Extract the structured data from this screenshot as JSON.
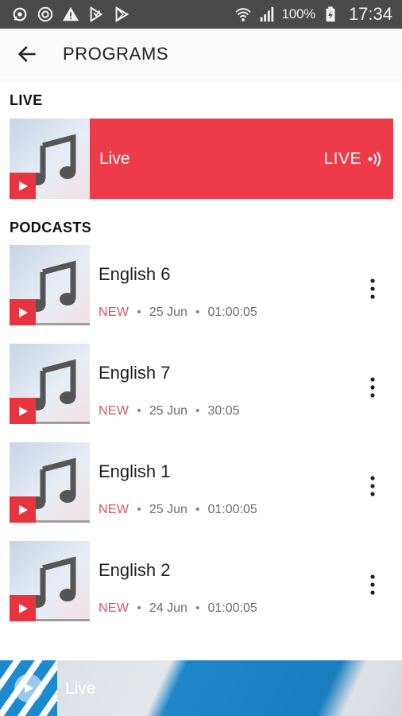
{
  "status_bar": {
    "left_icons": [
      "whatsapp-icon",
      "sync-icon",
      "warning-icon",
      "download-icon",
      "play-store-icon"
    ],
    "right_icons": [
      "wifi-icon",
      "signal-icon",
      "battery-charging-icon"
    ],
    "battery": "100%",
    "time": "17:34"
  },
  "app_bar": {
    "back_icon": "arrow-left-icon",
    "title": "PROGRAMS"
  },
  "live_section": {
    "heading": "LIVE",
    "item": {
      "title": "Live",
      "badge": "LIVE",
      "badge_icon": "broadcast-icon"
    }
  },
  "podcasts_section": {
    "heading": "PODCASTS",
    "items": [
      {
        "title": "English 6",
        "status": "NEW",
        "date": "25 Jun",
        "duration": "01:00:05"
      },
      {
        "title": "English 7",
        "status": "NEW",
        "date": "25 Jun",
        "duration": "30:05"
      },
      {
        "title": "English 1",
        "status": "NEW",
        "date": "25 Jun",
        "duration": "01:00:05"
      },
      {
        "title": "English 2",
        "status": "NEW",
        "date": "24 Jun",
        "duration": "01:00:05"
      }
    ],
    "separator": "•"
  },
  "mini_player": {
    "title": "Live",
    "icon": "play-icon"
  },
  "colors": {
    "accent": "#ee3b49",
    "new_badge": "#e05262",
    "status_bar": "#4a4a4a"
  }
}
